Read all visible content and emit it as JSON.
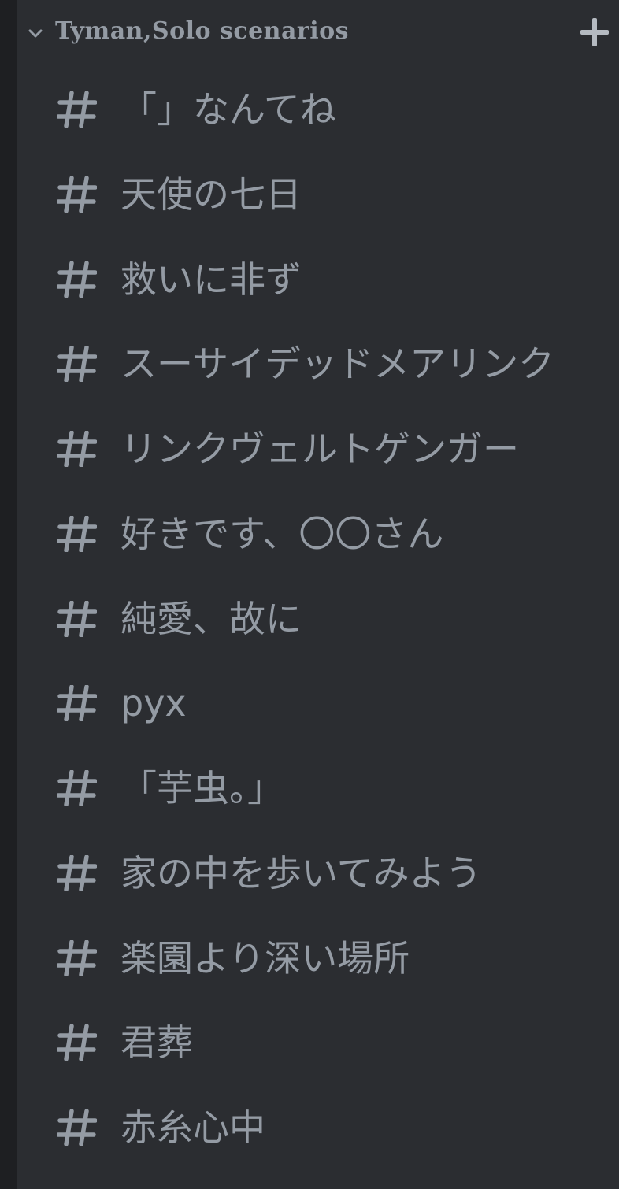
{
  "category": {
    "title": "Tyman,Solo scenarios",
    "icons": {
      "collapse": "chevron-down-icon",
      "add": "plus-icon"
    }
  },
  "channels": [
    {
      "name": "「」なんてね"
    },
    {
      "name": "天使の七日"
    },
    {
      "name": "救いに非ず"
    },
    {
      "name": "スーサイデッドメアリンク"
    },
    {
      "name": "リンクヴェルトゲンガー"
    },
    {
      "name": "好きです、〇〇さん"
    },
    {
      "name": "純愛、故に"
    },
    {
      "name": "pyx"
    },
    {
      "name": "「芋虫。」"
    },
    {
      "name": "家の中を歩いてみよう"
    },
    {
      "name": "楽園より深い場所"
    },
    {
      "name": "君葬"
    },
    {
      "name": "赤糸心中"
    }
  ],
  "colors": {
    "background": "#2b2d31",
    "rail": "#1e1f22",
    "muted_text": "#949ba4"
  }
}
